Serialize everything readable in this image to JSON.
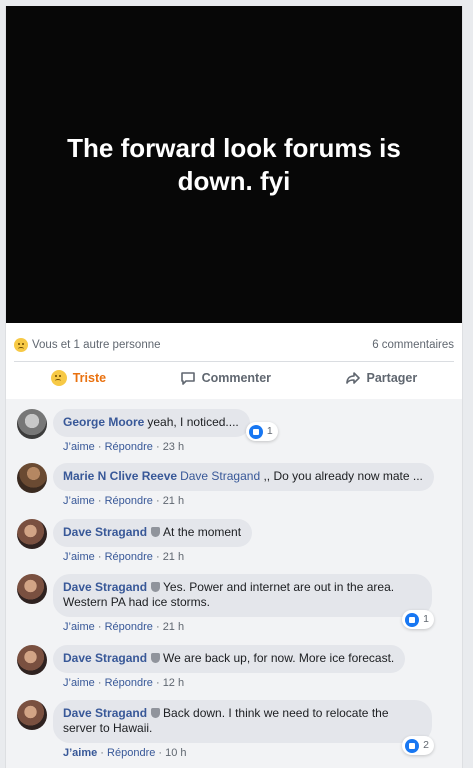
{
  "post": {
    "text": "The forward look forums is down. fyi"
  },
  "summary": {
    "reactions_text": "Vous et 1 autre personne",
    "comment_count": "6 commentaires"
  },
  "actions": {
    "react_label": "Triste",
    "comment_label": "Commenter",
    "share_label": "Partager"
  },
  "icons": {
    "reaction": "sad-face-icon",
    "comment": "speech-bubble-icon",
    "share": "share-arrow-icon",
    "like": "thumbs-up-icon",
    "badge": "shield-badge-icon"
  },
  "comments": [
    {
      "author": "George Moore",
      "mention": "",
      "text": "yeah, I noticed....",
      "like_label": "J’aime",
      "reply_label": "Répondre",
      "time": "23 h",
      "likes": "1"
    },
    {
      "author": "Marie N Clive Reeve",
      "mention": "Dave Stragand",
      "text": ",, Do you already now mate ...",
      "like_label": "J’aime",
      "reply_label": "Répondre",
      "time": "21 h",
      "likes": ""
    },
    {
      "author": "Dave Stragand",
      "mention": "",
      "text": "At the moment",
      "like_label": "J’aime",
      "reply_label": "Répondre",
      "time": "21 h",
      "likes": ""
    },
    {
      "author": "Dave Stragand",
      "mention": "",
      "text": "Yes. Power and internet are out in the area. Western PA had ice storms.",
      "like_label": "J’aime",
      "reply_label": "Répondre",
      "time": "21 h",
      "likes": "1"
    },
    {
      "author": "Dave Stragand",
      "mention": "",
      "text": "We are back up, for now. More ice forecast.",
      "like_label": "J’aime",
      "reply_label": "Répondre",
      "time": "12 h",
      "likes": ""
    },
    {
      "author": "Dave Stragand",
      "mention": "",
      "text": "Back down. I think we need to relocate the server to Hawaii.",
      "like_label": "J’aime",
      "reply_label": "Répondre",
      "time": "10 h",
      "likes": "2"
    }
  ],
  "colors": {
    "link": "#385898",
    "active_reaction": "#e9710f",
    "like_blue": "#1877f2"
  }
}
